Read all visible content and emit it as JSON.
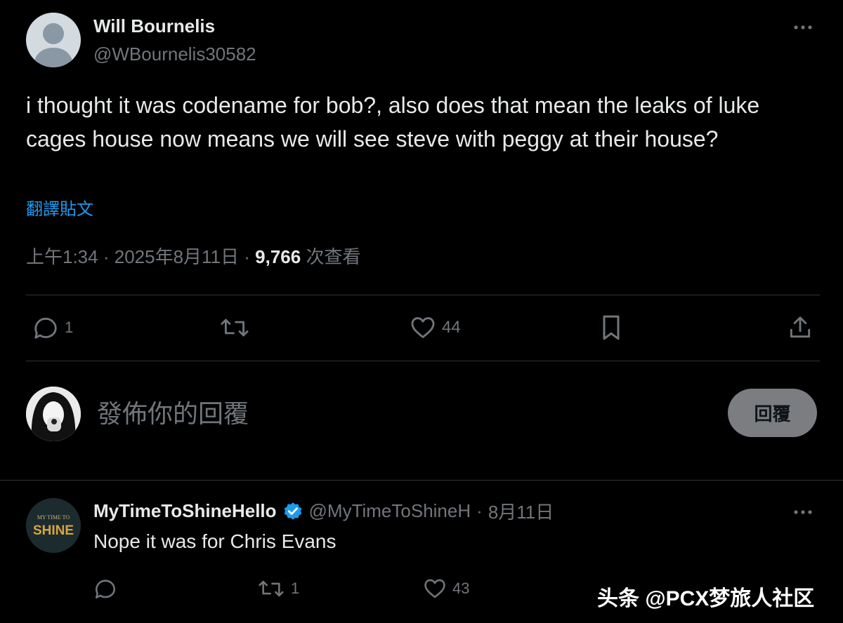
{
  "tweet": {
    "author_name": "Will Bournelis",
    "author_handle": "@WBournelis30582",
    "text": "i thought it was codename for bob?, also does that mean the leaks of luke cages house now means we will see steve with peggy at their house?",
    "translate_label": "翻譯貼文",
    "time": "上午1:34",
    "date": "2025年8月11日",
    "views_count": "9,766",
    "views_label": "次查看",
    "stats": {
      "replies": "1",
      "likes": "44"
    }
  },
  "composer": {
    "placeholder": "發佈你的回覆",
    "reply_button": "回覆"
  },
  "reply": {
    "author_name": "MyTimeToShineHello",
    "author_handle": "@MyTimeToShineH",
    "date": "8月11日",
    "avatar_text_top": "MY TIME TO",
    "avatar_text_bottom": "SHINE",
    "text": "Nope it was for Chris Evans",
    "stats": {
      "reposts": "1",
      "likes": "43"
    }
  },
  "watermark": "头条 @PCX梦旅人社区",
  "colors": {
    "background": "#000000",
    "text": "#e7e9ea",
    "secondary": "#71767b",
    "link": "#1d9bf0",
    "verified": "#1d9bf0",
    "divider": "#2f3336"
  },
  "icons": [
    "more-icon",
    "reply-icon",
    "repost-icon",
    "like-icon",
    "bookmark-icon",
    "share-icon",
    "verified-badge-icon"
  ]
}
